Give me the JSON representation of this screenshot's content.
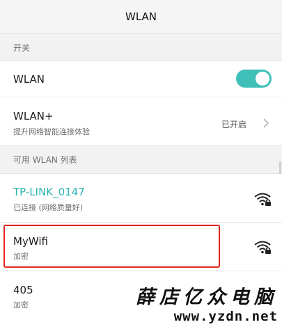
{
  "header": {
    "title": "WLAN"
  },
  "switch_section": {
    "label": "开关"
  },
  "wlan_row": {
    "label": "WLAN",
    "enabled": true,
    "toggle_color": "#3ebfb8"
  },
  "wlan_plus_row": {
    "label": "WLAN+",
    "description": "提升网络智能连接体验",
    "status": "已开启"
  },
  "available_section": {
    "label": "可用 WLAN 列表"
  },
  "networks": [
    {
      "name": "TP-LINK_0147",
      "status": "已连接 (网络质量好)",
      "connected": true,
      "name_color": "#2ab3b0",
      "icon": "wifi-locked-icon"
    },
    {
      "name": "MyWifi",
      "status": "加密",
      "connected": false,
      "highlighted": true,
      "icon": "wifi-locked-icon"
    },
    {
      "name": "405",
      "status": "加密",
      "connected": false
    }
  ],
  "watermark": {
    "name": "薛店亿众电脑",
    "url": "www.yzdn.net"
  },
  "colors": {
    "highlight": "#e2261f",
    "accent": "#3ebfb8",
    "connected": "#2ab3b0"
  }
}
